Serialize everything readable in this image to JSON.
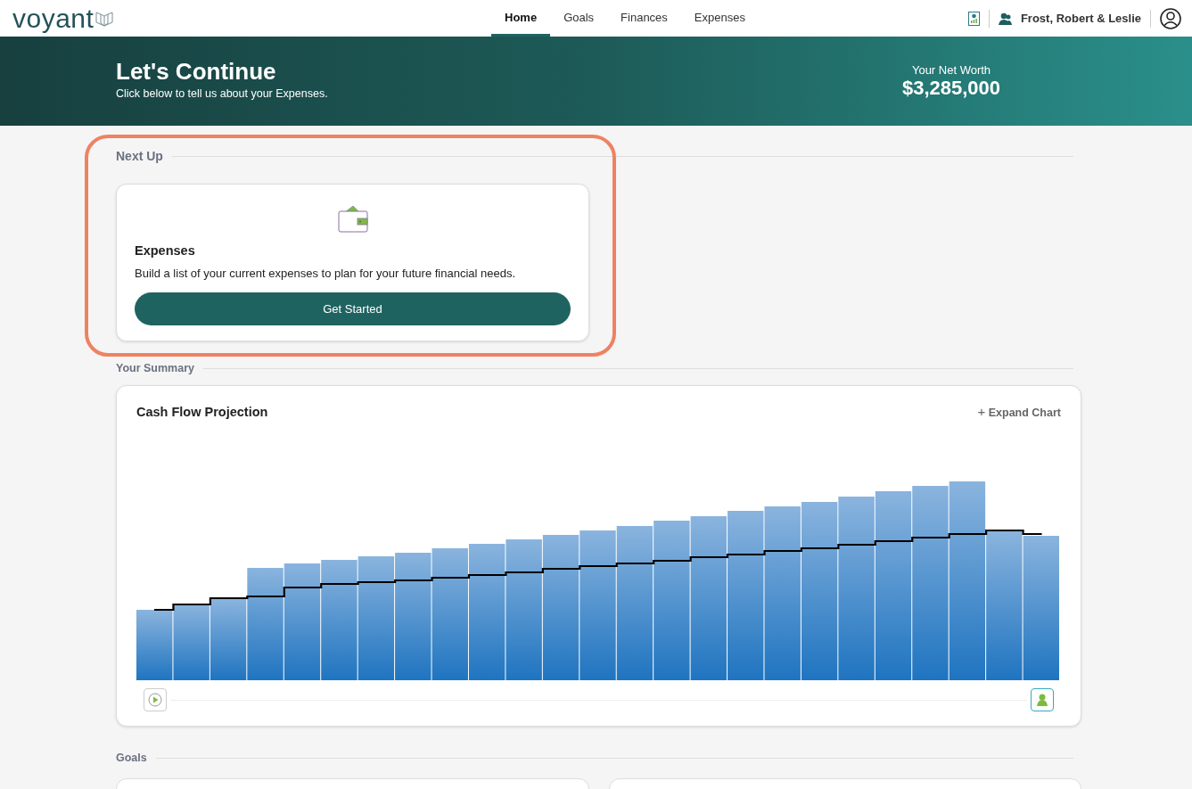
{
  "brand": {
    "name": "voyant"
  },
  "nav": {
    "tabs": [
      {
        "label": "Home",
        "selected": true
      },
      {
        "label": "Goals",
        "selected": false
      },
      {
        "label": "Finances",
        "selected": false
      },
      {
        "label": "Expenses",
        "selected": false
      }
    ],
    "user": "Frost, Robert & Leslie"
  },
  "banner": {
    "title": "Let's Continue",
    "subtitle": "Click below to tell us about your Expenses.",
    "net_worth_label": "Your Net Worth",
    "net_worth": "$3,285,000"
  },
  "next_up": {
    "heading": "Next Up",
    "card": {
      "title": "Expenses",
      "description": "Build a list of your current expenses to plan for your future financial needs.",
      "button": "Get Started"
    }
  },
  "summary": {
    "heading": "Your Summary",
    "card": {
      "title": "Cash Flow Projection",
      "expand": "Expand Chart",
      "expand_icon": "+"
    }
  },
  "goals": {
    "heading": "Goals"
  }
}
